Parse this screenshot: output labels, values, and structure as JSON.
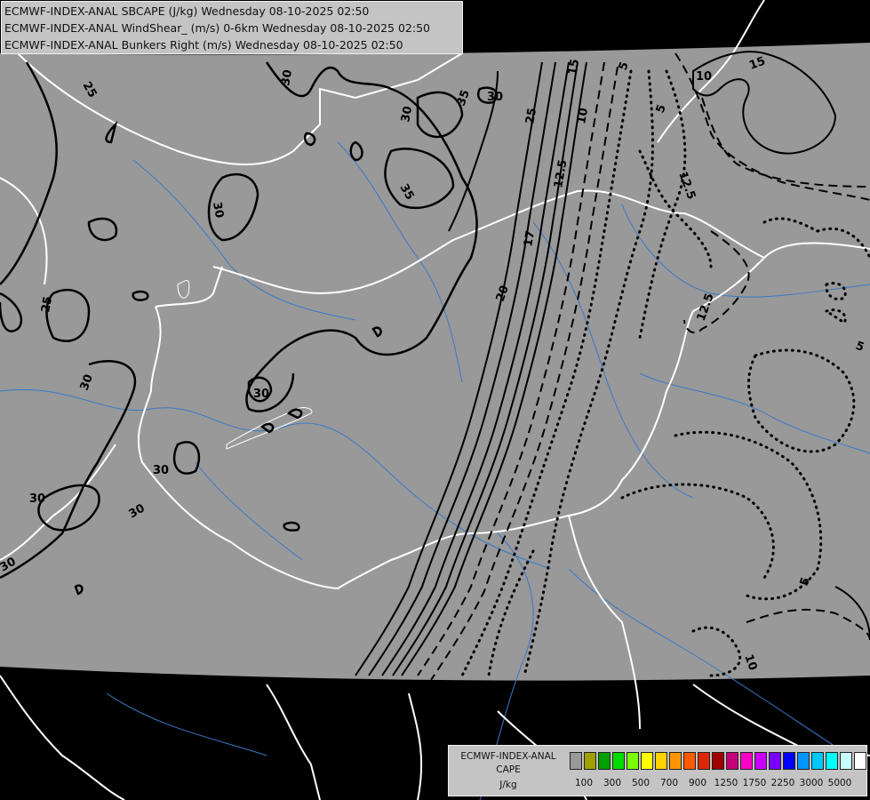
{
  "header": {
    "line1": "ECMWF-INDEX-ANAL SBCAPE (J/kg) Wednesday 08-10-2025 02:50",
    "line2": "ECMWF-INDEX-ANAL WindShear_ (m/s) 0-6km Wednesday 08-10-2025 02:50",
    "line3": "ECMWF-INDEX-ANAL Bunkers Right (m/s) Wednesday 08-10-2025 02:50"
  },
  "legend": {
    "title1": "ECMWF-INDEX-ANAL",
    "title2": "CAPE",
    "title3": "J/kg",
    "colors": [
      "#9a9a9a",
      "#a0a000",
      "#00a000",
      "#00dc00",
      "#78ff00",
      "#ffff00",
      "#ffd200",
      "#ff9600",
      "#ff5a00",
      "#dc2800",
      "#a00000",
      "#c80078",
      "#ff00c8",
      "#c800ff",
      "#7800ff",
      "#0000ff",
      "#0096ff",
      "#00c8ff",
      "#00ffff",
      "#c8ffff",
      "#ffffff"
    ],
    "ticks": [
      "100",
      "300",
      "500",
      "700",
      "900",
      "1250",
      "1750",
      "2250",
      "3000",
      "5000"
    ]
  },
  "map": {
    "background_color": "#000000",
    "domain_color": "#999999",
    "border_color": "#ffffff",
    "river_color": "#3a78c8",
    "contour_color": "#000000",
    "cape_labels": [
      "25",
      "30",
      "30",
      "30",
      "35",
      "35",
      "30",
      "30",
      "25",
      "30",
      "30",
      "30",
      "30",
      "30"
    ],
    "shear_labels": [
      "25",
      "20",
      "17",
      "12.5",
      "10",
      "15",
      "12.5",
      "10",
      "15",
      "12.5"
    ],
    "bunkers_labels": [
      "5",
      "5",
      "5",
      "5",
      "10"
    ]
  }
}
